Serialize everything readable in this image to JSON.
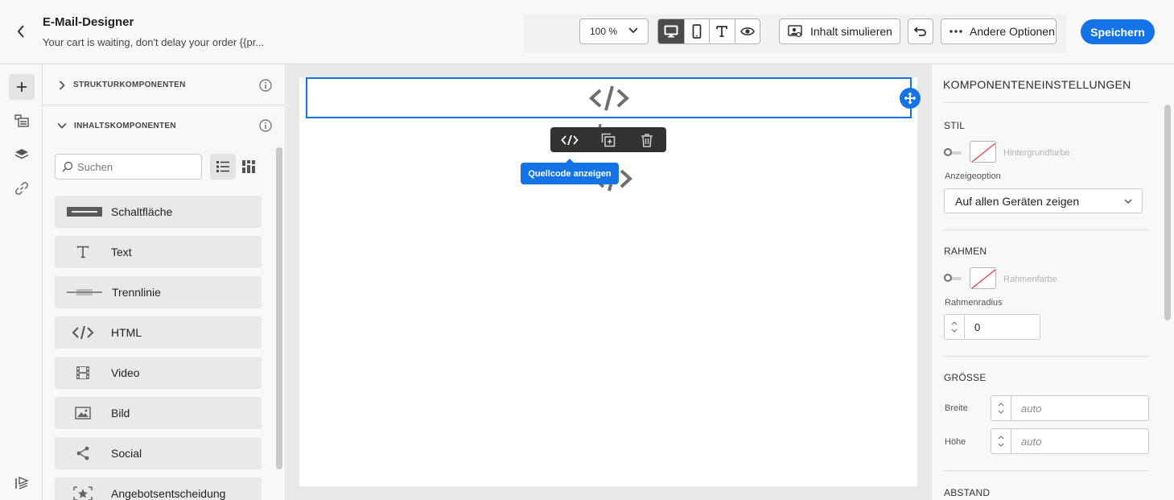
{
  "header": {
    "title": "E-Mail-Designer",
    "subtitle": "Your cart is waiting, don't delay your order {{pr...",
    "zoom": "100 %",
    "simulate_label": "Inhalt simulieren",
    "more_label": "Andere Optionen",
    "save_label": "Speichern",
    "view_modes": [
      "desktop-icon",
      "mobile-icon",
      "text-icon",
      "preview-eye-icon"
    ]
  },
  "rail": [
    "add-icon",
    "fragments-icon",
    "layers-icon",
    "link-icon",
    "settings-layers-icon"
  ],
  "left_panel": {
    "structure_label": "STRUKTURKOMPONENTEN",
    "content_label": "INHALTSKOMPONENTEN",
    "search_placeholder": "Suchen",
    "components": [
      {
        "label": "Schaltfläche",
        "icon": "button-icon"
      },
      {
        "label": "Text",
        "icon": "text-icon"
      },
      {
        "label": "Trennlinie",
        "icon": "divider-icon"
      },
      {
        "label": "HTML",
        "icon": "html-code-icon"
      },
      {
        "label": "Video",
        "icon": "video-icon"
      },
      {
        "label": "Bild",
        "icon": "image-icon"
      },
      {
        "label": "Social",
        "icon": "share-icon"
      },
      {
        "label": "Angebotsentscheidung",
        "icon": "offer-icon"
      }
    ]
  },
  "canvas": {
    "tooltip": "Quellcode anzeigen",
    "context_toolbar": [
      "code-icon",
      "duplicate-icon",
      "delete-icon"
    ]
  },
  "right_panel": {
    "title": "KOMPONENTENEINSTELLUNGEN",
    "style_section": "STIL",
    "background_color_label": "Hintergrundfarbe",
    "display_option_label": "Anzeigeoption",
    "display_option_value": "Auf allen Geräten zeigen",
    "border_section": "RAHMEN",
    "border_color_label": "Rahmenfarbe",
    "border_radius_label": "Rahmenradius",
    "border_radius_value": "0",
    "size_section": "GRÖSSE",
    "width_label": "Breite",
    "width_placeholder": "auto",
    "height_label": "Höhe",
    "height_placeholder": "auto",
    "spacing_section": "ABSTAND"
  },
  "colors": {
    "accent": "#1473e6",
    "toolbar_dark": "#323232"
  }
}
